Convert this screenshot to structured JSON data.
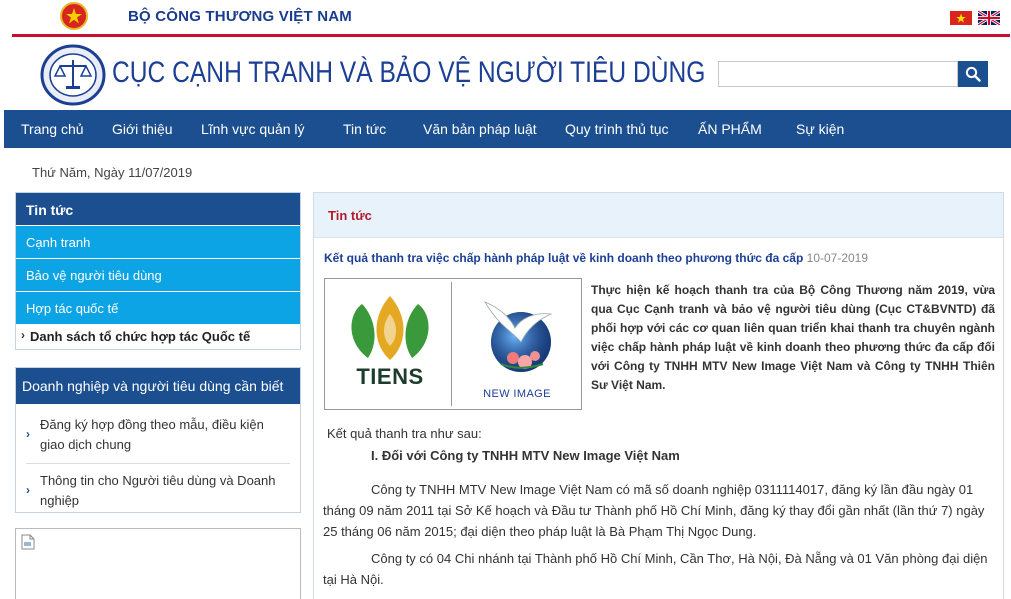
{
  "top_bar": {
    "ministry_name": "BỘ CÔNG THƯƠNG VIỆT NAM",
    "emblem_icon": "national-emblem-icon",
    "flags": [
      "vietnam-flag-icon",
      "uk-flag-icon"
    ]
  },
  "header": {
    "site_title": "CỤC CẠNH TRANH VÀ BẢO VỆ NGƯỜI TIÊU DÙNG",
    "logo_icon": "agency-seal-icon",
    "search_placeholder": "",
    "search_icon": "search-icon"
  },
  "nav": {
    "items": [
      "Trang chủ",
      "Giới thiệu",
      "Lĩnh vực quản lý",
      "Tin tức",
      "Văn bản pháp luật",
      "Quy trình thủ tục",
      "ẤN PHẨM",
      "Sự kiện"
    ]
  },
  "date_text": "Thứ Năm, Ngày 11/07/2019",
  "sidebar": {
    "news": {
      "heading": "Tin tức",
      "links": [
        "Cạnh tranh",
        "Bảo vệ người tiêu dùng",
        "Hợp tác quốc tế"
      ],
      "sub_link": "Danh sách tổ chức hợp tác Quốc tế"
    },
    "guide": {
      "heading": "Doanh nghiệp và người tiêu dùng cần biết",
      "items": [
        "Đăng ký hợp đồng theo mẫu, điều kiện giao dịch chung",
        "Thông tin cho Người tiêu dùng và Doanh nghiệp"
      ]
    }
  },
  "main": {
    "section_title": "Tin tức",
    "article": {
      "title": "Kết quả thanh tra việc chấp hành pháp luật về kinh doanh theo phương thức đa cấp",
      "date": "10-07-2019",
      "image_logos": [
        "TIENS",
        "NEW IMAGE"
      ],
      "intro": "Thực hiện kế hoạch thanh tra của Bộ Công Thương năm 2019, vừa qua Cục Cạnh tranh và bảo vệ người tiêu dùng (Cục CT&BVNTD) đã phối hợp với các cơ quan liên quan triển khai thanh tra chuyên ngành việc chấp hành pháp luật về kinh doanh theo phương thức đa cấp đối với Công ty TNHH MTV New Image Việt Nam và Công ty TNHH Thiên Sư Việt Nam.",
      "result_lead": "Kết quả thanh tra như sau:",
      "section_heading": "I. Đối với Công ty TNHH MTV New Image Việt Nam",
      "para1": "Công ty TNHH MTV New Image Việt Nam có mã số doanh nghiệp 0311114017, đăng ký lần đầu ngày 01 tháng 09 năm 2011 tại Sở Kế hoạch và Đầu tư Thành phố Hồ Chí Minh, đăng ký thay đổi gần nhất (lần thứ 7) ngày 25 tháng 06 năm 2015; đại diện theo pháp luật là Bà Phạm Thị Ngọc Dung.",
      "para2": "Công ty có 04 Chi nhánh tại Thành phố Hồ Chí Minh, Cần Thơ, Hà Nội, Đà Nẵng và 01 Văn phòng đại diện tại Hà Nội."
    }
  },
  "colors": {
    "nav_blue": "#1c4f8f",
    "link_cyan": "#0da4e6",
    "accent_red": "#c8102e",
    "title_blue": "#1c3f95"
  }
}
